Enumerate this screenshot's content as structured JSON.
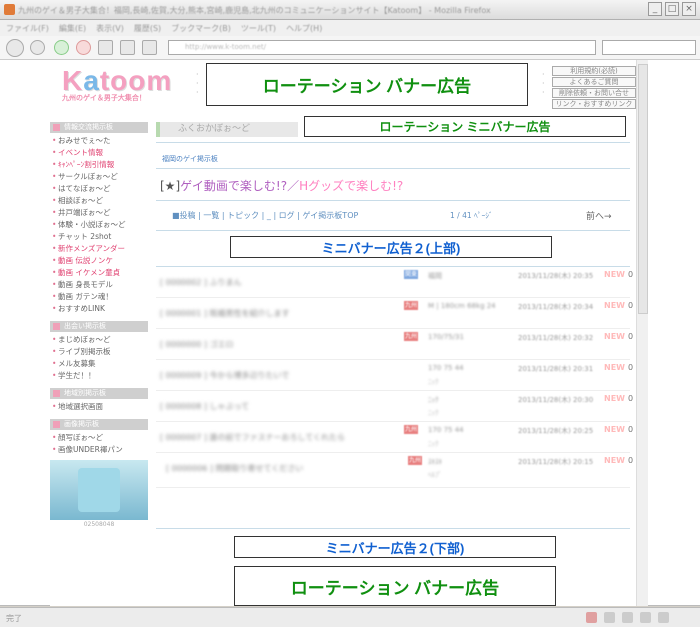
{
  "browser": {
    "title": "九州のゲイ＆男子大集合！福岡,長崎,佐賀,大分,熊本,宮崎,鹿児島,北九州のコミュニケーションサイト【Katoom】 - Mozilla Firefox",
    "menu": [
      "ファイル(F)",
      "編集(E)",
      "表示(V)",
      "履歴(S)",
      "ブックマーク(B)",
      "ツール(T)",
      "ヘルプ(H)"
    ],
    "url": "http://www.k-toom.net/",
    "window_buttons": [
      "_",
      "□",
      "×"
    ],
    "status": "完了"
  },
  "header": {
    "logo": "Katoom",
    "tagline": "九州のゲイ＆男子大集合！",
    "ad_rotation_top": "ローテーション バナー広告",
    "links": [
      "利用規約(必読)",
      "よくあるご質問",
      "削除依頼・お問い合せ",
      "リンク・おすすめリンク"
    ]
  },
  "sidebar": {
    "section1": "情報交流掲示板",
    "items1": [
      {
        "label": "おみせでぇ～た",
        "pink": false
      },
      {
        "label": "イベント情報",
        "pink": true
      },
      {
        "label": "ｷｬﾝﾍﾟｰﾝ割引情報",
        "pink": true
      },
      {
        "label": "サークルぼぉ～ど",
        "pink": false
      },
      {
        "label": "はてなぼぉ～ど",
        "pink": false
      },
      {
        "label": "相談ぼぉ～ど",
        "pink": false
      },
      {
        "label": "井戸端ぼぉ～ど",
        "pink": false
      },
      {
        "label": "体験・小説ぼぉ～ど",
        "pink": false
      },
      {
        "label": "チャット 2shot",
        "pink": false
      },
      {
        "label": "新作メンズアンダー",
        "pink": true
      },
      {
        "label": "動画 伝説ノンケ",
        "pink": true
      },
      {
        "label": "動画 イケメン童貞",
        "pink": true
      },
      {
        "label": "動画 身長モデル",
        "pink": false
      },
      {
        "label": "動画 ガテン魂！",
        "pink": false
      },
      {
        "label": "おすすめLINK",
        "pink": false
      }
    ],
    "section2": "出会い掲示板",
    "items2": [
      {
        "label": "まじめぼぉ～ど"
      },
      {
        "label": "ライブ別掲示板"
      },
      {
        "label": "メル友募集"
      },
      {
        "label": "学生だ！！"
      }
    ],
    "section3": "地域別掲示板",
    "items3": [
      {
        "label": "地域選択画面"
      }
    ],
    "section4": "画像掲示板",
    "items4": [
      {
        "label": "顔写ぼぉ～ど"
      },
      {
        "label": "画像UNDER褌パン"
      }
    ],
    "photo_caption": "02508048"
  },
  "main": {
    "kids_tab": "ふくおかぼぉ～ど",
    "mini_banner_top": "ローテーション ミニバナー広告",
    "board_label": "福岡のゲイ掲示板",
    "board_title_bracket": "[★]",
    "board_title_a": "ゲイ動画で楽しむ!?",
    "board_title_sep": "／",
    "board_title_b": "Hグッズで楽しむ!?",
    "nav": "■投稿 | 一覧 | トピック | _ | ログ | ゲイ掲示板TOP",
    "page_info": "1 / 41 ﾍﾟｰｼﾞ",
    "prev_next": "前へ→",
    "mini_banner2_top": "ミニバナー広告２(上部)",
    "mini_banner2_bottom": "ミニバナー広告２(下部)",
    "rotation_banner_bottom": "ローテーション バナー広告"
  },
  "rows": [
    {
      "id": "[ 0000002 ] ふりまん",
      "tag": "関東",
      "who": "福岡",
      "sub": "",
      "date": "2013/11/28(木) 20:35",
      "new": "NEW",
      "count": "0"
    },
    {
      "id": "[ 0000001 ] 既婚男性を紹介します",
      "tag": "九州",
      "who": "M | 180cm 68kg 24",
      "sub": "",
      "date": "2013/11/28(木) 20:34",
      "new": "NEW",
      "count": "0"
    },
    {
      "id": "[ 0000000 ] ゴエロ",
      "tag": "九州",
      "who": "170/75/31",
      "sub": "",
      "date": "2013/11/28(木) 20:32",
      "new": "NEW",
      "count": "0"
    },
    {
      "id": "[ 0000009 ] 今から博多辺りたいで",
      "tag": "",
      "who": "170 75 44",
      "sub": "ﾆｯｸ",
      "date": "2013/11/28(木) 20:31",
      "new": "NEW",
      "count": "0"
    },
    {
      "id": "[ 0000008 ] しゃぶって",
      "tag": "",
      "who": "ﾆｯｸ",
      "sub": "ﾆｯｸ",
      "date": "2013/11/28(木) 20:30",
      "new": "NEW",
      "count": "0"
    },
    {
      "id": "[ 0000007 ] 誰の前でファスナーおろしてくれたら",
      "tag": "九州",
      "who": "170 75 44",
      "sub": "ﾆｯｸ",
      "date": "2013/11/28(木) 20:25",
      "new": "NEW",
      "count": "0"
    },
    {
      "id": "[ 0000006 ] 問題取り寄せてください",
      "tag": "九州",
      "who": "ｽｷｽｷ",
      "sub": "ﾍﾙﾌﾟ",
      "date": "2013/11/28(木) 20:15",
      "new": "NEW",
      "count": "0"
    }
  ],
  "colors": {
    "ad_green": "#109010",
    "ad_blue": "#1060d0",
    "pink": "#e04070",
    "new": "#ff8080"
  }
}
